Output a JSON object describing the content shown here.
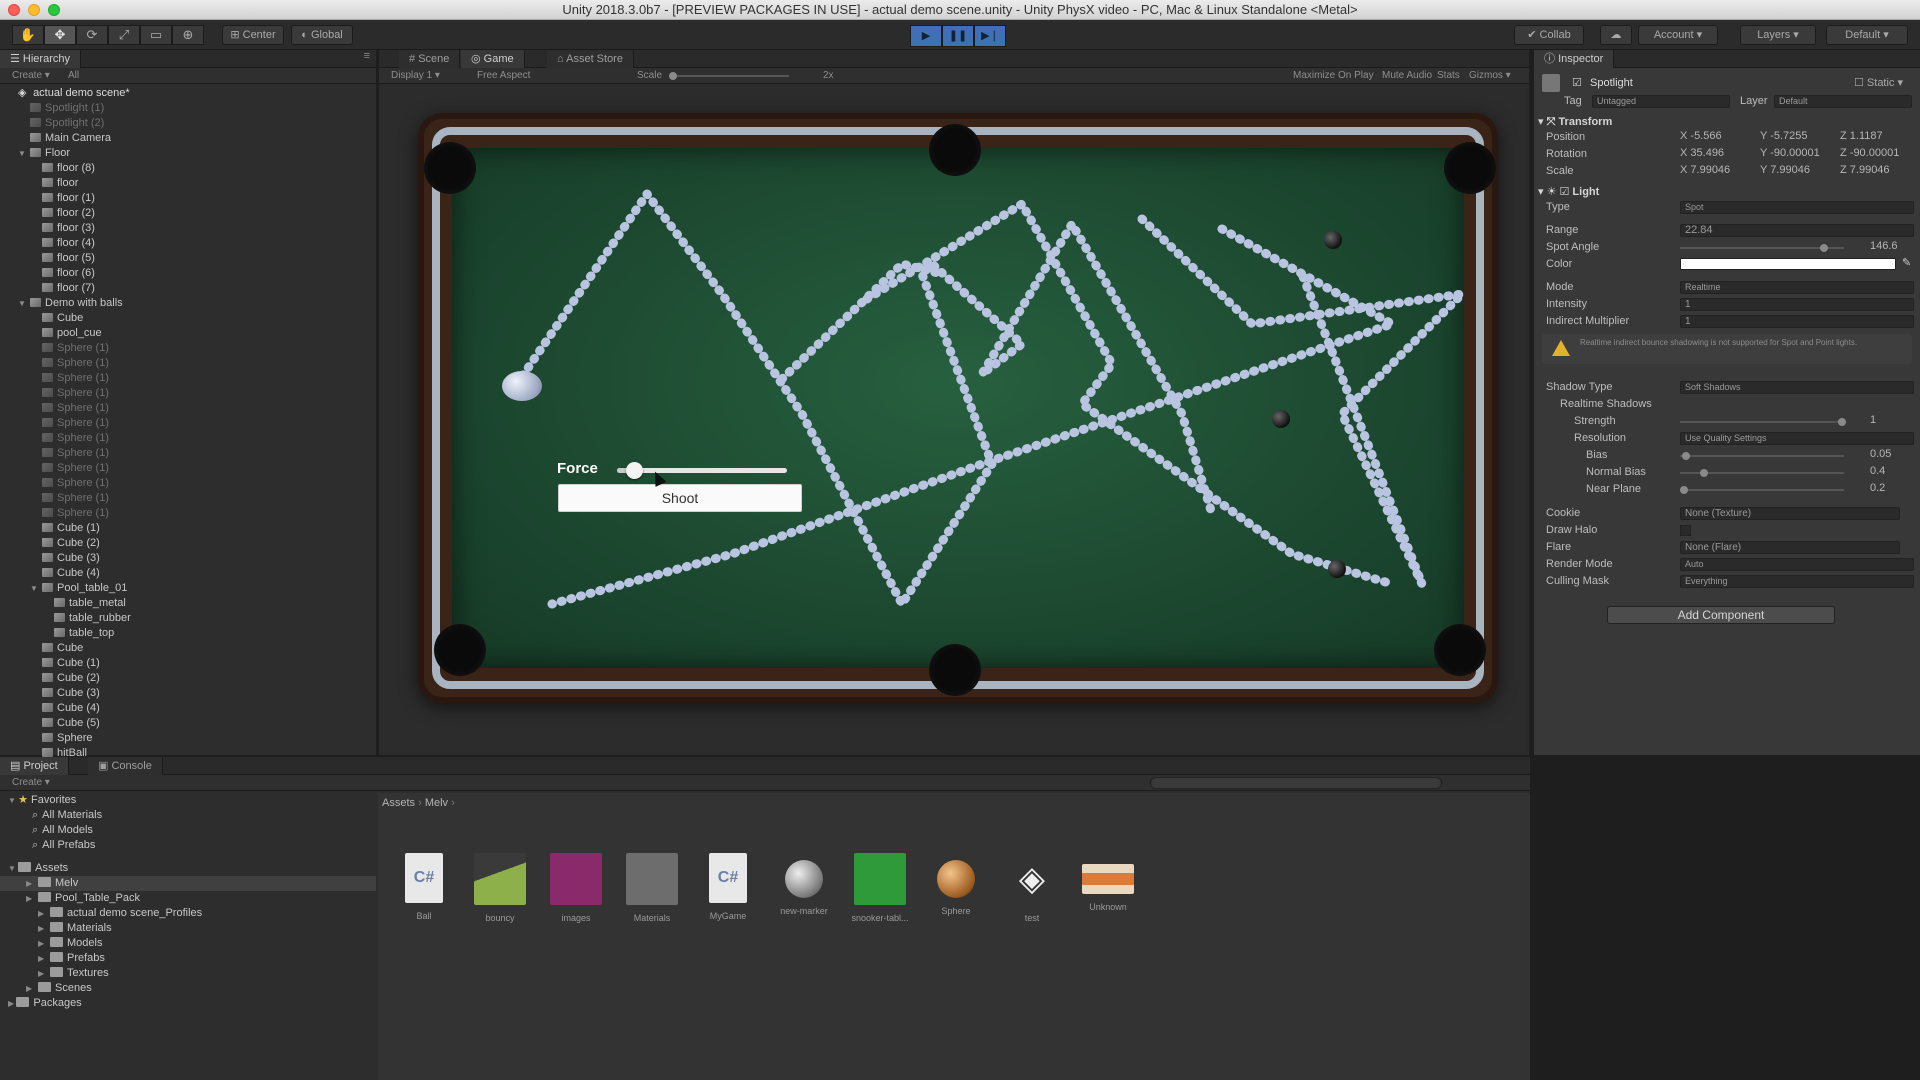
{
  "window": {
    "title": "Unity 2018.3.0b7 - [PREVIEW PACKAGES IN USE] - actual demo scene.unity - Unity PhysX video - PC, Mac & Linux Standalone <Metal>"
  },
  "toolbar": {
    "center_label": "Center",
    "global_label": "Global",
    "collab_label": "Collab",
    "account_label": "Account",
    "layers_label": "Layers",
    "layout_label": "Default"
  },
  "hierarchy": {
    "tab": "Hierarchy",
    "create": "Create",
    "search_placeholder": "All",
    "scene_name": "actual demo scene*",
    "items": [
      {
        "label": "Spotlight (1)",
        "indent": 1,
        "dim": true
      },
      {
        "label": "Spotlight (2)",
        "indent": 1,
        "dim": true
      },
      {
        "label": "Main Camera",
        "indent": 1,
        "dim": false
      },
      {
        "label": "Floor",
        "indent": 1,
        "dim": false,
        "expanded": true
      },
      {
        "label": "floor (8)",
        "indent": 2,
        "dim": false
      },
      {
        "label": "floor",
        "indent": 2,
        "dim": false
      },
      {
        "label": "floor (1)",
        "indent": 2,
        "dim": false
      },
      {
        "label": "floor (2)",
        "indent": 2,
        "dim": false
      },
      {
        "label": "floor (3)",
        "indent": 2,
        "dim": false
      },
      {
        "label": "floor (4)",
        "indent": 2,
        "dim": false
      },
      {
        "label": "floor (5)",
        "indent": 2,
        "dim": false
      },
      {
        "label": "floor (6)",
        "indent": 2,
        "dim": false
      },
      {
        "label": "floor (7)",
        "indent": 2,
        "dim": false
      },
      {
        "label": "Demo with balls",
        "indent": 1,
        "dim": false,
        "expanded": true
      },
      {
        "label": "Cube",
        "indent": 2,
        "dim": false
      },
      {
        "label": "pool_cue",
        "indent": 2,
        "dim": false
      },
      {
        "label": "Sphere (1)",
        "indent": 2,
        "dim": true
      },
      {
        "label": "Sphere (1)",
        "indent": 2,
        "dim": true
      },
      {
        "label": "Sphere (1)",
        "indent": 2,
        "dim": true
      },
      {
        "label": "Sphere (1)",
        "indent": 2,
        "dim": true
      },
      {
        "label": "Sphere (1)",
        "indent": 2,
        "dim": true
      },
      {
        "label": "Sphere (1)",
        "indent": 2,
        "dim": true
      },
      {
        "label": "Sphere (1)",
        "indent": 2,
        "dim": true
      },
      {
        "label": "Sphere (1)",
        "indent": 2,
        "dim": true
      },
      {
        "label": "Sphere (1)",
        "indent": 2,
        "dim": true
      },
      {
        "label": "Sphere (1)",
        "indent": 2,
        "dim": true
      },
      {
        "label": "Sphere (1)",
        "indent": 2,
        "dim": true
      },
      {
        "label": "Sphere (1)",
        "indent": 2,
        "dim": true
      },
      {
        "label": "Cube (1)",
        "indent": 2,
        "dim": false
      },
      {
        "label": "Cube (2)",
        "indent": 2,
        "dim": false
      },
      {
        "label": "Cube (3)",
        "indent": 2,
        "dim": false
      },
      {
        "label": "Cube (4)",
        "indent": 2,
        "dim": false
      },
      {
        "label": "Pool_table_01",
        "indent": 2,
        "dim": false,
        "expanded": true
      },
      {
        "label": "table_metal",
        "indent": 3,
        "dim": false
      },
      {
        "label": "table_rubber",
        "indent": 3,
        "dim": false
      },
      {
        "label": "table_top",
        "indent": 3,
        "dim": false
      },
      {
        "label": "Cube",
        "indent": 2,
        "dim": false
      },
      {
        "label": "Cube (1)",
        "indent": 2,
        "dim": false
      },
      {
        "label": "Cube (2)",
        "indent": 2,
        "dim": false
      },
      {
        "label": "Cube (3)",
        "indent": 2,
        "dim": false
      },
      {
        "label": "Cube (4)",
        "indent": 2,
        "dim": false
      },
      {
        "label": "Cube (5)",
        "indent": 2,
        "dim": false
      },
      {
        "label": "Sphere",
        "indent": 2,
        "dim": false
      },
      {
        "label": "hitBall",
        "indent": 2,
        "dim": false
      }
    ]
  },
  "views": {
    "tabs": [
      "Scene",
      "Game",
      "Asset Store"
    ],
    "active_tab": "Game",
    "display": "Display 1",
    "aspect": "Free Aspect",
    "scale_label": "Scale",
    "scale_value": "2x",
    "maximize": "Maximize On Play",
    "mute": "Mute Audio",
    "stats": "Stats",
    "gizmos": "Gizmos"
  },
  "game_ui": {
    "force_label": "Force",
    "force_value": 0.1,
    "shoot_label": "Shoot"
  },
  "inspector": {
    "tab": "Inspector",
    "object_name": "Spotlight",
    "static_label": "Static",
    "tag_label": "Tag",
    "tag_value": "Untagged",
    "layer_label": "Layer",
    "layer_value": "Default",
    "transform": {
      "title": "Transform",
      "position_label": "Position",
      "position": {
        "x": "-5.566",
        "y": "-5.7255",
        "z": "1.1187"
      },
      "rotation_label": "Rotation",
      "rotation": {
        "x": "35.496",
        "y": "-90.00001",
        "z": "-90.00001"
      },
      "scale_label": "Scale",
      "scale": {
        "x": "7.99046",
        "y": "7.99046",
        "z": "7.99046"
      }
    },
    "light": {
      "title": "Light",
      "type_label": "Type",
      "type_value": "Spot",
      "range_label": "Range",
      "range_value": "22.84",
      "spot_angle_label": "Spot Angle",
      "spot_angle_value": "146.6",
      "color_label": "Color",
      "color_value": "#ffffff",
      "mode_label": "Mode",
      "mode_value": "Realtime",
      "intensity_label": "Intensity",
      "intensity_value": "1",
      "indirect_label": "Indirect Multiplier",
      "indirect_value": "1",
      "warning": "Realtime indirect bounce shadowing is not supported for Spot and Point lights.",
      "shadow_type_label": "Shadow Type",
      "shadow_type_value": "Soft Shadows",
      "realtime_shadows_label": "Realtime Shadows",
      "strength_label": "Strength",
      "strength_value": "1",
      "resolution_label": "Resolution",
      "resolution_value": "Use Quality Settings",
      "bias_label": "Bias",
      "bias_value": "0.05",
      "normal_bias_label": "Normal Bias",
      "normal_bias_value": "0.4",
      "near_plane_label": "Near Plane",
      "near_plane_value": "0.2",
      "cookie_label": "Cookie",
      "cookie_value": "None (Texture)",
      "draw_halo_label": "Draw Halo",
      "flare_label": "Flare",
      "flare_value": "None (Flare)",
      "render_mode_label": "Render Mode",
      "render_mode_value": "Auto",
      "culling_mask_label": "Culling Mask",
      "culling_mask_value": "Everything"
    },
    "add_component": "Add Component"
  },
  "project": {
    "tabs": [
      "Project",
      "Console"
    ],
    "create": "Create",
    "favorites_label": "Favorites",
    "favorites": [
      "All Materials",
      "All Models",
      "All Prefabs"
    ],
    "assets_label": "Assets",
    "tree": [
      {
        "label": "Melv",
        "indent": 1,
        "selected": true
      },
      {
        "label": "Pool_Table_Pack",
        "indent": 1,
        "selected": false
      },
      {
        "label": "actual demo scene_Profiles",
        "indent": 2,
        "selected": false
      },
      {
        "label": "Materials",
        "indent": 2,
        "selected": false
      },
      {
        "label": "Models",
        "indent": 2,
        "selected": false
      },
      {
        "label": "Prefabs",
        "indent": 2,
        "selected": false
      },
      {
        "label": "Textures",
        "indent": 2,
        "selected": false
      },
      {
        "label": "Scenes",
        "indent": 1,
        "selected": false
      }
    ],
    "packages_label": "Packages",
    "breadcrumb": [
      "Assets",
      "Melv"
    ],
    "assets": [
      {
        "label": "Ball",
        "kind": "cs"
      },
      {
        "label": "bouncy",
        "kind": "physmat"
      },
      {
        "label": "images",
        "kind": "image"
      },
      {
        "label": "Materials",
        "kind": "folder"
      },
      {
        "label": "MyGame",
        "kind": "cs"
      },
      {
        "label": "new-marker",
        "kind": "sphere-grey"
      },
      {
        "label": "snooker-tabl...",
        "kind": "green"
      },
      {
        "label": "Sphere",
        "kind": "sphere-orange"
      },
      {
        "label": "test",
        "kind": "unity"
      },
      {
        "label": "Unknown",
        "kind": "texture"
      }
    ]
  }
}
